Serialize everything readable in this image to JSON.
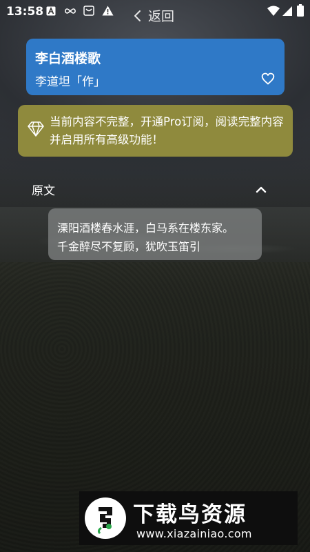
{
  "status_bar": {
    "time": "13:58",
    "left_icons": [
      "font-a-icon",
      "infinity-icon",
      "message-box-icon",
      "warning-icon"
    ],
    "right_icons": [
      "wifi-icon",
      "signal-icon",
      "battery-icon"
    ]
  },
  "nav": {
    "back_label": "返回",
    "back_icon": "chevron-left-icon"
  },
  "poem": {
    "title": "李白酒楼歌",
    "author": "李道坦「作」",
    "favorite_icon": "heart-outline-icon",
    "accent_color": "#2f79c7"
  },
  "pro_banner": {
    "icon": "diamond-icon",
    "text": "当前内容不完整，开通Pro订阅，阅读完整内容并启用所有高级功能！",
    "color": "#8f8a3d"
  },
  "original_section": {
    "label": "原文",
    "toggle_icon": "chevron-up-icon",
    "lines": [
      "溧阳酒楼春水涯，白马系在楼东家。",
      "千金醉尽不复顾，犹吹玉笛引"
    ]
  },
  "watermark": {
    "title": "下载鸟资源",
    "url": "www.xiazainiao.com",
    "logo_icon": "bird-logo-icon"
  }
}
